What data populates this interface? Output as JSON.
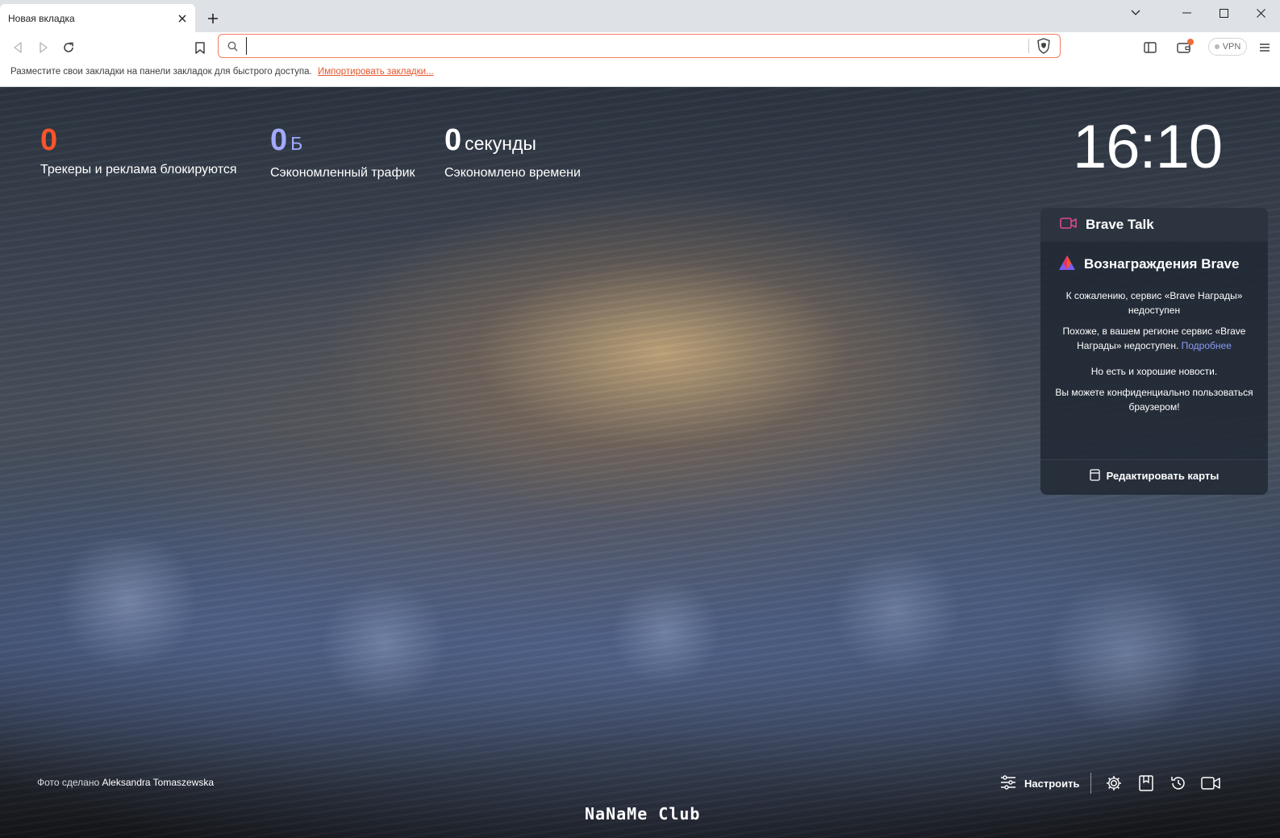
{
  "tab": {
    "title": "Новая вкладка"
  },
  "omnibox": {
    "value": ""
  },
  "toolbar": {
    "vpn_label": "VPN"
  },
  "bookmarks_bar": {
    "message": "Разместите свои закладки на панели закладок для быстрого доступа.",
    "import_link": "Импортировать закладки..."
  },
  "stats": {
    "trackers": {
      "value": "0",
      "label": "Трекеры и реклама блокируются",
      "color": "#fb542b"
    },
    "bandwidth": {
      "value": "0",
      "unit": "Б",
      "label": "Сэкономленный трафик",
      "color": "#a3a9ff"
    },
    "time": {
      "value": "0",
      "unit": "секунды",
      "label": "Сэкономлено времени",
      "color": "#ffffff"
    }
  },
  "clock": {
    "time": "16:10"
  },
  "widget": {
    "talk_title": "Brave Talk",
    "rewards_title": "Вознаграждения Brave",
    "unavailable_title": "К сожалению, сервис «Brave Награды» недоступен",
    "region_text": "Похоже, в вашем регионе сервис «Brave Награды» недоступен.",
    "learn_more": "Подробнее",
    "good_news": "Но есть и хорошие новости.",
    "private_text": "Вы можете конфиденциально пользоваться браузером!",
    "edit_cards": "Редактировать карты"
  },
  "credit": {
    "prefix": "Фото сделано",
    "author": "Aleksandra Tomaszewska"
  },
  "bottom": {
    "customize": "Настроить"
  },
  "watermark": "NaNaMe Club"
}
